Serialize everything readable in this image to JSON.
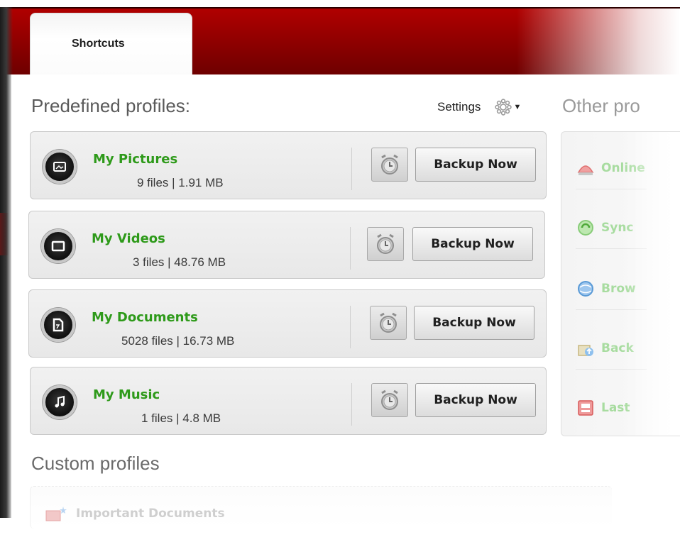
{
  "tabs": [
    {
      "label": "Shortcuts"
    }
  ],
  "predefined": {
    "title": "Predefined profiles:",
    "settings_label": "Settings",
    "profiles": [
      {
        "name": "My Pictures",
        "meta": "9 files | 1.91 MB",
        "icon": "picture-icon",
        "action": "Backup Now"
      },
      {
        "name": "My Videos",
        "meta": "3 files | 48.76 MB",
        "icon": "video-icon",
        "action": "Backup Now"
      },
      {
        "name": "My Documents",
        "meta": "5028 files | 16.73 MB",
        "icon": "document-icon",
        "action": "Backup Now"
      },
      {
        "name": "My Music",
        "meta": "1 files | 4.8 MB",
        "icon": "music-icon",
        "action": "Backup Now"
      }
    ]
  },
  "other": {
    "title": "Other pro",
    "items": [
      {
        "label": "Online",
        "icon": "online-storage-icon"
      },
      {
        "label": "Sync",
        "icon": "sync-icon"
      },
      {
        "label": "Brow",
        "icon": "browse-icon"
      },
      {
        "label": "Back",
        "icon": "backup-icon"
      },
      {
        "label": "Last",
        "icon": "last-backup-icon"
      }
    ]
  },
  "custom": {
    "title": "Custom profiles",
    "items": [
      {
        "label": "Important Documents",
        "icon": "important-documents-icon"
      }
    ]
  },
  "colors": {
    "header_red": "#a00000",
    "profile_name_green": "#2e9a1a",
    "other_item_green": "#a8dca0"
  }
}
